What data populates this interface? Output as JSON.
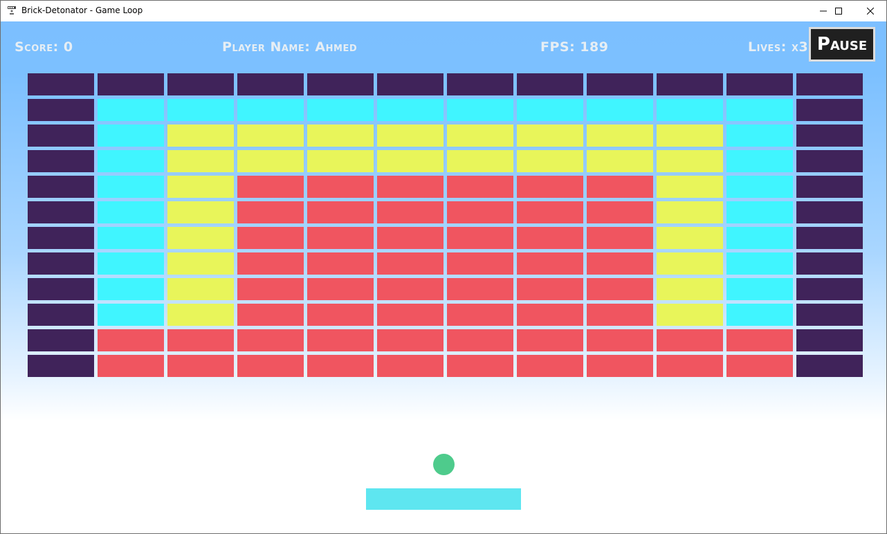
{
  "window": {
    "title": "Brick-Detonator - Game Loop",
    "controls": [
      "minimize-icon",
      "maximize-icon",
      "close-icon"
    ]
  },
  "hud": {
    "score": "Score: 0",
    "player": "Player Name: Ahmed",
    "fps": "FPS: 189",
    "lives": "Lives: x3",
    "pause_label": "Pause"
  },
  "colors": {
    "sky_top": "#7cc0ff",
    "purple": "#40235a",
    "cyan": "#40f5ff",
    "yellow": "#e8f55a",
    "red": "#f05560",
    "ball": "#4ecb8c",
    "paddle": "#5ee6f0"
  },
  "bricks": {
    "legend": {
      "P": "purple",
      "C": "cyan",
      "Y": "yellow",
      "R": "red"
    },
    "rows": [
      "PPPPPPPPPPPP",
      "PCCCCCCCCCCP",
      "PCYYYYYYYYCP",
      "PCYYYYYYYYCP",
      "PCYRRRRRRYCP",
      "PCYRRRRRRYCP",
      "PCYRRRRRRYCP",
      "PCYRRRRRRYCP",
      "PCYRRRRRRYCP",
      "PCYRRRRRRYCP",
      "PRRRRRRRRRRP",
      "PRRRRRRRRRRP"
    ]
  }
}
